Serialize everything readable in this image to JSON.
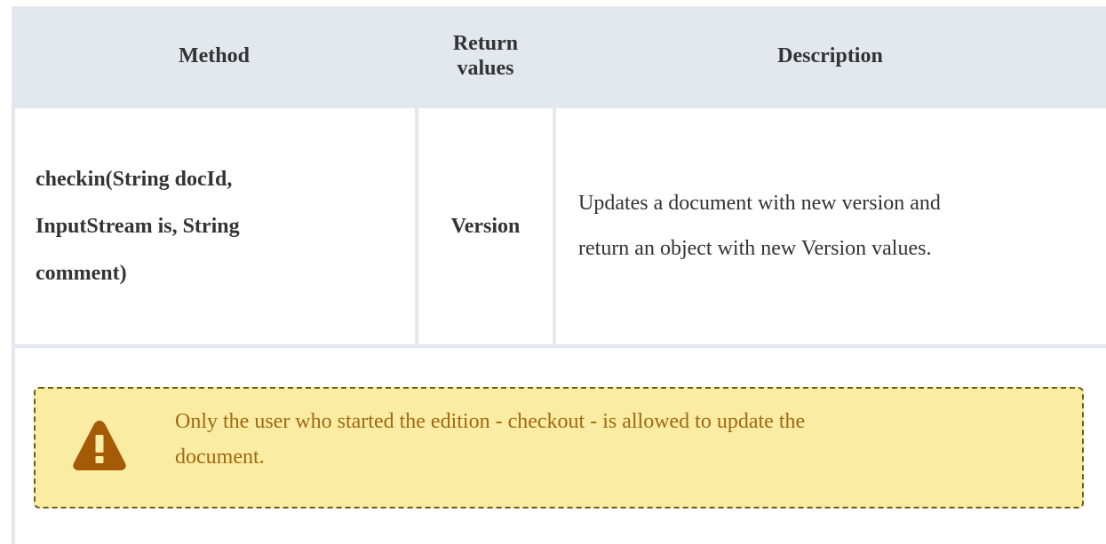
{
  "table": {
    "headers": {
      "method": "Method",
      "return_values_line1": "Return",
      "return_values_line2": "values",
      "description": "Description"
    },
    "rows": [
      {
        "method_line1": "checkin(String docId,",
        "method_line2": "InputStream is, String",
        "method_line3": "comment)",
        "return_value": "Version",
        "description_line1": "Updates a document with new version and",
        "description_line2": "return an object with new Version values."
      }
    ]
  },
  "warning": {
    "icon": "warning-triangle-icon",
    "text_line1": "Only the user who started the edition - checkout - is allowed to update the",
    "text_line2": "document.",
    "colors": {
      "background": "#fbeca4",
      "border": "#6b5b1b",
      "text": "#a1680e",
      "icon": "#a55a05"
    }
  },
  "colors": {
    "header_background": "#e3e7ee",
    "text": "#333333"
  }
}
